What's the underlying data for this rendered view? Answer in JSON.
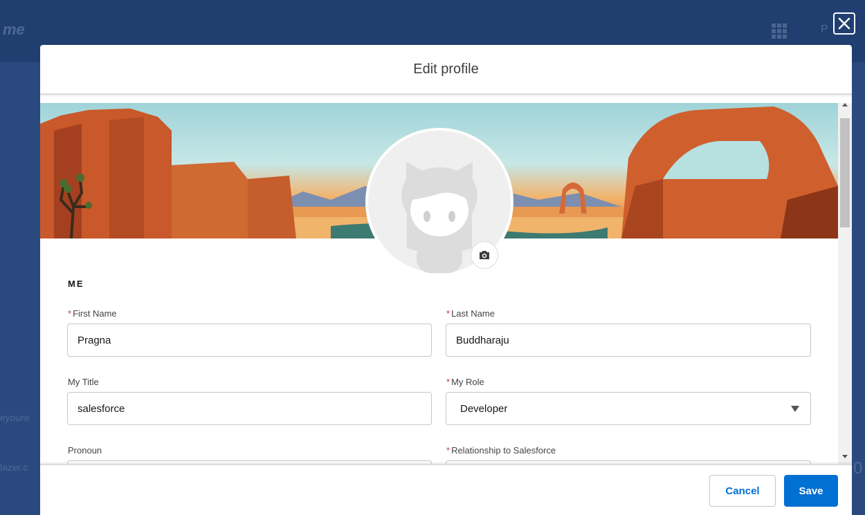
{
  "background": {
    "logo_text": "me",
    "side_text_a": "eyoure",
    "side_text_b": "lazer.c",
    "right_text_p": "P",
    "right_text_num": "0"
  },
  "modal": {
    "title": "Edit profile",
    "section_label": "ME",
    "required_marker": "*",
    "fields": {
      "first_name": {
        "label": "First Name",
        "value": "Pragna",
        "required": true
      },
      "last_name": {
        "label": "Last Name",
        "value": "Buddharaju",
        "required": true
      },
      "my_title": {
        "label": "My Title",
        "value": "salesforce",
        "required": false
      },
      "my_role": {
        "label": "My Role",
        "value": "Developer",
        "required": true
      },
      "pronoun": {
        "label": "Pronoun",
        "value": "",
        "required": false
      },
      "relationship": {
        "label": "Relationship to Salesforce",
        "value": "",
        "required": true
      }
    },
    "footer": {
      "cancel_label": "Cancel",
      "save_label": "Save"
    }
  },
  "colors": {
    "brand_blue": "#0070d2",
    "required_red": "#c23934",
    "backdrop_blue": "#2a4a82"
  },
  "icons": [
    "close-icon",
    "camera-icon",
    "chevron-down-icon",
    "app-launcher-icon",
    "avatar-icon"
  ]
}
